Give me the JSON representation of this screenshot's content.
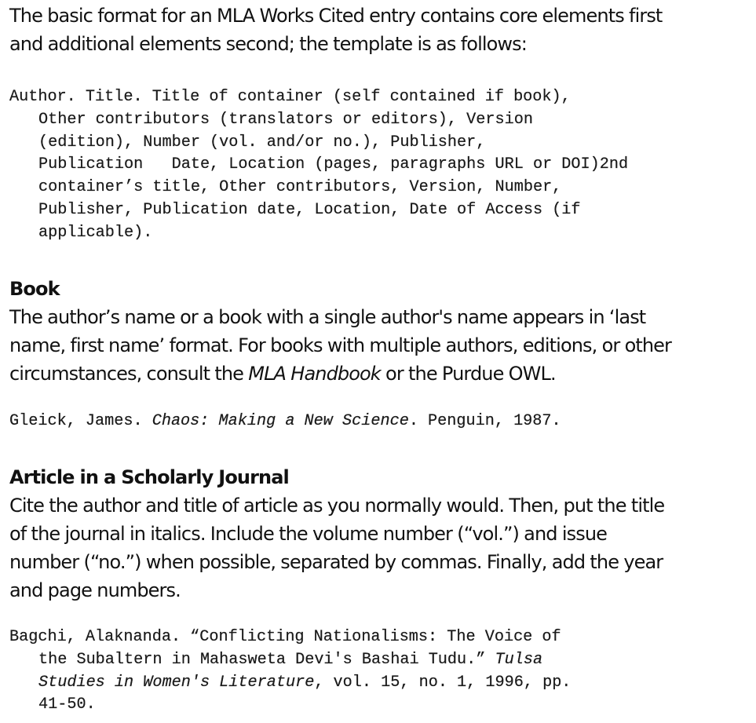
{
  "intro": {
    "line1": "The basic format for an MLA Works Cited entry contains core elements first",
    "line2": "and additional elements second; the template is as follows:"
  },
  "template_entry": {
    "lines": [
      "Author. Title. Title of container (self contained if book),",
      "Other contributors (translators or editors), Version",
      "(edition), Number (vol. and/or no.), Publisher,",
      "Publication   Date, Location (pages, paragraphs URL or DOI)2nd",
      "container’s title, Other contributors, Version, Number,",
      "Publisher, Publication date, Location, Date of Access (if",
      "applicable)."
    ]
  },
  "book": {
    "heading": "Book",
    "desc_line1": "The author’s name or a book with a single author's name appears in ‘last",
    "desc_line2": "name, first name’ format. For books with multiple authors, editions, or other",
    "desc_line3_pre": "circumstances, consult the ",
    "desc_line3_italic": "MLA Handbook",
    "desc_line3_post": " or the Purdue OWL.",
    "example": {
      "author": "Gleick, James. ",
      "title": "Chaos: Making a New Science",
      "rest": ". Penguin, 1987."
    }
  },
  "article": {
    "heading": "Article in a Scholarly Journal",
    "desc_lines": [
      "Cite the author and title of article as you normally would. Then, put the title",
      "of the journal in italics. Include the volume number (“vol.”) and issue",
      "number (“no.”) when possible, separated by commas. Finally, add the year",
      "and page numbers."
    ],
    "example": {
      "line1": "Bagchi, Alaknanda. “Conflicting Nationalisms: The Voice of",
      "line2_pre": "the Subaltern in Mahasweta Devi's Bashai Tudu.” ",
      "line2_italic": "Tulsa",
      "line3_italic": "Studies in Women's Literature",
      "line3_post": ", vol. 15, no. 1, 1996, pp.",
      "line4": "41-50."
    }
  }
}
